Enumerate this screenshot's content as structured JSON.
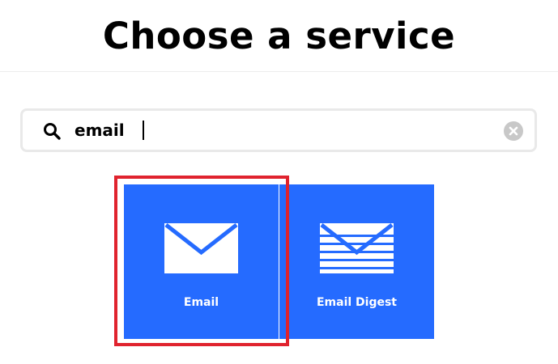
{
  "header": {
    "title": "Choose a service"
  },
  "search": {
    "value": "email",
    "icon": "search-icon",
    "clear_icon": "clear-icon"
  },
  "services": [
    {
      "label": "Email",
      "icon": "envelope-icon",
      "selected": true
    },
    {
      "label": "Email Digest",
      "icon": "envelope-digest-icon",
      "selected": false
    }
  ],
  "colors": {
    "tile": "#256bff",
    "highlight": "#e0232e",
    "search_border": "#e9e9e9",
    "clear_button": "#c8c8c8"
  }
}
